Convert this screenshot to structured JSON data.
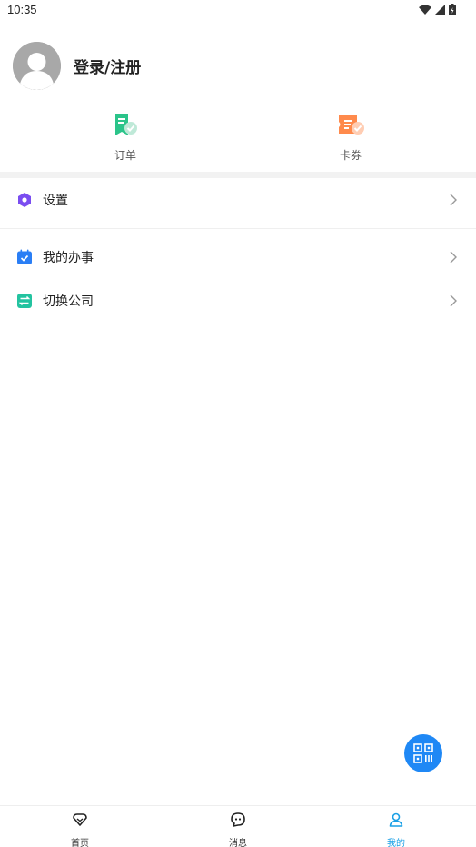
{
  "status_bar": {
    "time": "10:35"
  },
  "profile": {
    "login_label": "登录/注册"
  },
  "quick_entries": [
    {
      "label": "订单",
      "icon": "order-icon"
    },
    {
      "label": "卡券",
      "icon": "coupon-icon"
    }
  ],
  "menu": [
    {
      "label": "设置",
      "icon": "settings-icon"
    },
    {
      "label": "我的办事",
      "icon": "calendar-check-icon"
    },
    {
      "label": "切换公司",
      "icon": "switch-icon"
    }
  ],
  "bottom_nav": [
    {
      "label": "首页",
      "icon": "home-icon",
      "active": false
    },
    {
      "label": "消息",
      "icon": "message-icon",
      "active": false
    },
    {
      "label": "我的",
      "icon": "profile-icon",
      "active": true
    }
  ],
  "colors": {
    "accent": "#1aa0e6",
    "fab": "#1f88f5",
    "order_green": "#2bc48a",
    "coupon_orange": "#ff8a4c",
    "settings_purple": "#7a4df0",
    "calendar_blue": "#2a7ef5",
    "switch_teal": "#23c3a0"
  }
}
